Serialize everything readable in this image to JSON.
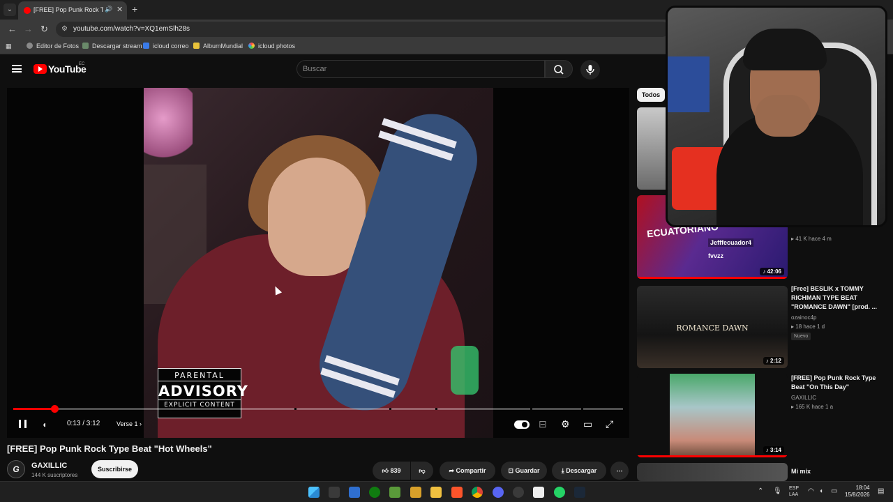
{
  "browser": {
    "tab_title": "[FREE] Pop Punk Rock Type",
    "url": "youtube.com/watch?v=XQ1emSlh28s",
    "bookmarks": [
      "Editor de Fotos",
      "Descargar stream",
      "icloud correo",
      "AlbumMundial",
      "icloud photos"
    ]
  },
  "header": {
    "logo_text": "YouTube",
    "country": "EC",
    "search_placeholder": "Buscar"
  },
  "player": {
    "current_time": "0:13",
    "duration": "3:12",
    "time_display": "0:13 / 3:12",
    "chapter": "Verse 1",
    "progress_fraction": 0.068,
    "advisory": {
      "line1": "PARENTAL",
      "line2": "ADVISORY",
      "line3": "EXPLICIT CONTENT"
    }
  },
  "video": {
    "title": "[FREE] Pop Punk Rock Type Beat \"Hot Wheels\"",
    "channel": "GAXILLIC",
    "subscribers": "144 K suscriptores",
    "subscribe_label": "Suscribirse",
    "likes": "839",
    "share_label": "Compartir",
    "save_label": "Guardar",
    "download_label": "Descargar"
  },
  "sidebar": {
    "chip": "Todos",
    "items": [
      {
        "thumb_text_1": "Jefffecuador4",
        "thumb_text_2": "fvvzz",
        "thumb_banner": "ECUATORIANO",
        "duration": "42:06",
        "meta": "41 K  hace 4 m"
      },
      {
        "title": "[Free] BESLIK x TOMMY RICHMAN TYPE BEAT \"ROMANCE DAWN\" [prod. ...",
        "thumb_text": "ROMANCE DAWN",
        "channel": "ozainoc4p",
        "meta": "18  hace 1 d",
        "badge": "Nuevo",
        "duration": "2:12"
      },
      {
        "title": "[FREE] Pop Punk Rock Type Beat \"On This Day\"",
        "channel": "GAXILLIC",
        "meta": "165 K  hace 1 a",
        "duration": "3:14"
      },
      {
        "title": "Mi mix"
      }
    ]
  },
  "taskbar": {
    "lang": "ESP",
    "lang2": "LAA",
    "time": "18:04",
    "date": "15/8/2026"
  },
  "colors": {
    "accent": "#ff0000",
    "background": "#0f0f0f"
  }
}
